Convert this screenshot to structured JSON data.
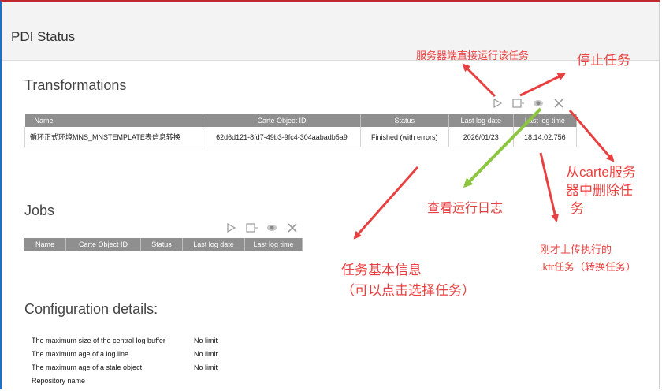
{
  "page": {
    "title": "PDI Status"
  },
  "transformations": {
    "heading": "Transformations",
    "columns": [
      "Name",
      "Carte Object ID",
      "Status",
      "Last log date",
      "Last log time"
    ],
    "rows": [
      {
        "name": "循环正式环境MNS_MNSTEMPLATE表信息转换",
        "carte_object_id": "62d6d121-8fd7-49b3-9fc4-304aabadb5a9",
        "status": "Finished (with errors)",
        "last_log_date": "2026/01/23",
        "last_log_time": "18:14:02.756"
      }
    ]
  },
  "jobs": {
    "heading": "Jobs",
    "columns": [
      "Name",
      "Carte Object ID",
      "Status",
      "Last log date",
      "Last log time"
    ]
  },
  "config": {
    "heading": "Configuration details:",
    "rows": [
      {
        "key": "The maximum size of the central log buffer",
        "value": "No limit"
      },
      {
        "key": "The maximum age of a log line",
        "value": "No limit"
      },
      {
        "key": "The maximum age of a stale object",
        "value": "No limit"
      },
      {
        "key": "Repository name",
        "value": ""
      }
    ]
  },
  "toolbar_icons": [
    "play-icon",
    "stop-icon",
    "eye-icon",
    "close-icon"
  ],
  "annotations": {
    "run_on_server": "服务器端直接运行该任务",
    "stop_task": "停止任务",
    "remove_line1": "从carte服务",
    "remove_line2": "器中删除任",
    "remove_line3": "务",
    "view_log": "查看运行日志",
    "basic_info_line1": "任务基本信息",
    "basic_info_line2": "（可以点击选择任务）",
    "uploaded_line1": "刚才上传执行的",
    "uploaded_line2": ".ktr任务（转换任务）"
  },
  "colors": {
    "annotation_red": "#e84040",
    "arrow_green": "#8cc63f",
    "header_gray": "#8f8f8f"
  }
}
